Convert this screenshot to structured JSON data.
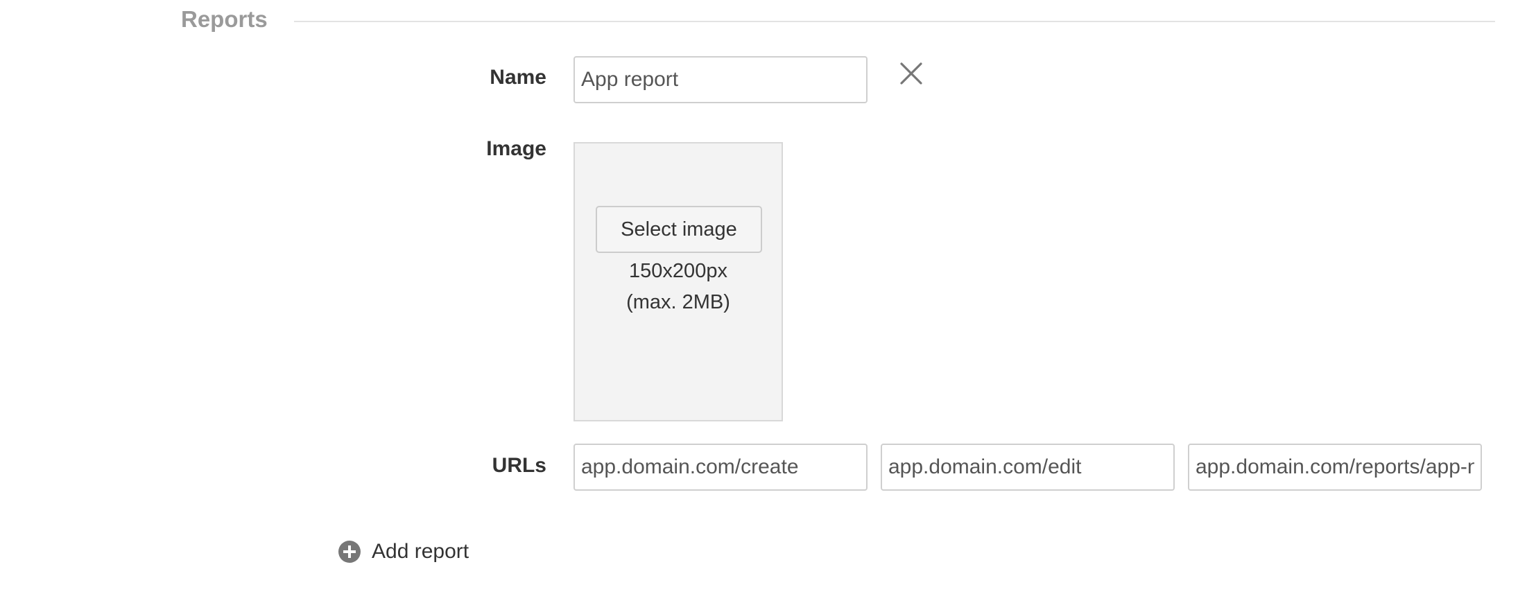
{
  "section": {
    "title": "Reports"
  },
  "report": {
    "name_label": "Name",
    "name_value": "App report",
    "remove_icon": "close-icon",
    "image_label": "Image",
    "select_image_label": "Select image",
    "image_size_hint": "150x200px",
    "image_max_hint": "(max. 2MB)",
    "urls_label": "URLs",
    "urls": [
      "app.domain.com/create",
      "app.domain.com/edit",
      "app.domain.com/reports/app-n"
    ]
  },
  "actions": {
    "add_report_label": "Add report",
    "add_report_icon": "plus-circle-icon"
  },
  "colors": {
    "section_title": "#9a9a9a",
    "text": "#333333",
    "input_border": "#cfcfcf",
    "image_box_bg": "#f3f3f3",
    "icon": "#777777"
  }
}
